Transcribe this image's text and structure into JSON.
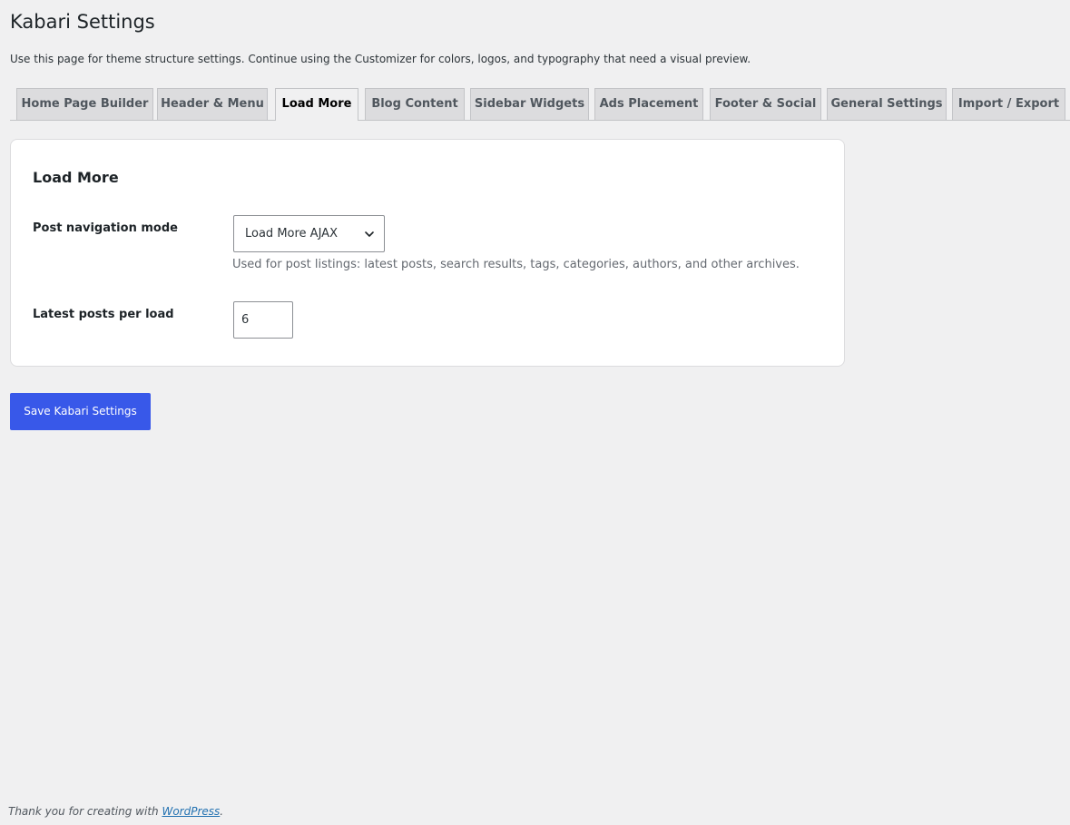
{
  "page": {
    "title": "Kabari Settings",
    "description": "Use this page for theme structure settings. Continue using the Customizer for colors, logos, and typography that need a visual preview."
  },
  "tabs": [
    {
      "label": "Home Page Builder",
      "active": false
    },
    {
      "label": "Header & Menu",
      "active": false
    },
    {
      "label": "Load More",
      "active": true
    },
    {
      "label": "Blog Content",
      "active": false
    },
    {
      "label": "Sidebar Widgets",
      "active": false
    },
    {
      "label": "Ads Placement",
      "active": false
    },
    {
      "label": "Footer & Social",
      "active": false
    },
    {
      "label": "General Settings",
      "active": false
    },
    {
      "label": "Import / Export",
      "active": false
    }
  ],
  "section": {
    "title": "Load More",
    "fields": {
      "navigation_mode": {
        "label": "Post navigation mode",
        "value": "Load More AJAX",
        "help": "Used for post listings: latest posts, search results, tags, categories, authors, and other archives."
      },
      "posts_per_load": {
        "label": "Latest posts per load",
        "value": "6"
      }
    }
  },
  "actions": {
    "save_label": "Save Kabari Settings"
  },
  "footer": {
    "prefix": "Thank you for creating with ",
    "link_text": "WordPress",
    "suffix": "."
  },
  "colors": {
    "background": "#f0f0f1",
    "primary_button": "#3858e9",
    "card": "#ffffff",
    "link": "#2271b1"
  },
  "icons": {
    "select_indicator": "chevron-down-icon"
  }
}
